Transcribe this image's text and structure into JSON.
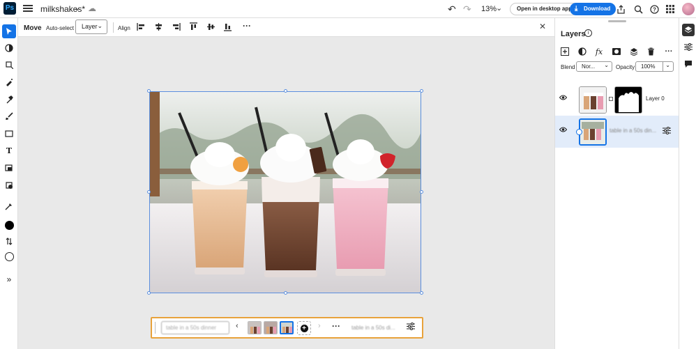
{
  "app": {
    "logo": "Ps",
    "document_name": "milkshakes*"
  },
  "topbar": {
    "zoom": "13%",
    "open_desktop_label": "Open in desktop app",
    "download_label": "Download"
  },
  "options": {
    "tool_name": "Move",
    "auto_select_label": "Auto-select",
    "layer_select_value": "Layer",
    "align_label": "Align"
  },
  "layers_panel": {
    "title": "Layers",
    "blend_label": "Blend",
    "blend_value": "Nor...",
    "opacity_label": "Opacity",
    "opacity_value": "100%",
    "layers": [
      {
        "name": "Layer 0",
        "selected": false
      },
      {
        "name": "table in a 50s din...",
        "selected": true
      }
    ]
  },
  "taskbar": {
    "prompt_value": "table in a 50s dinner",
    "generation_label": "table in a 50s di..."
  },
  "colors": {
    "accent": "#1473e6",
    "taskbar_highlight": "#e8a23b"
  }
}
